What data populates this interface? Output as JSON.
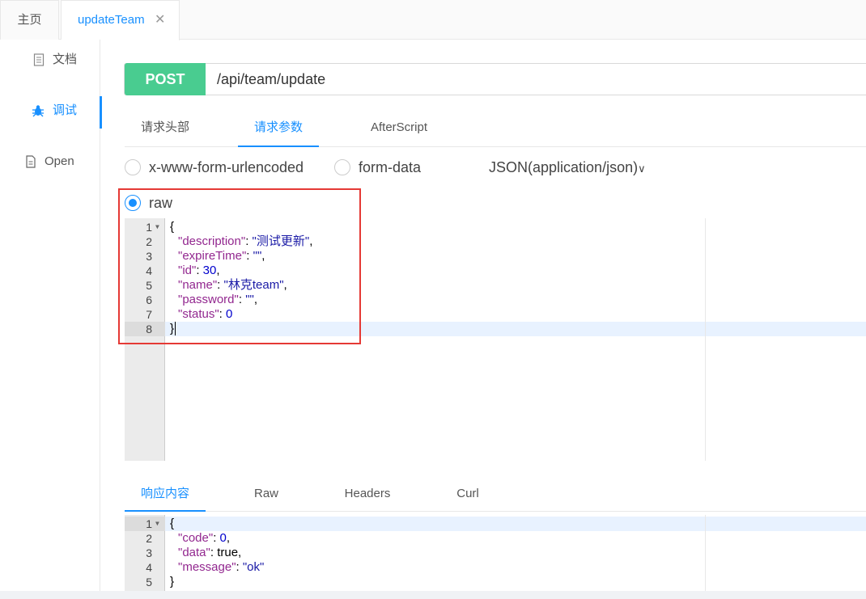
{
  "top_tabs": {
    "home": "主页",
    "active": "updateTeam",
    "close_glyph": "✕"
  },
  "sidebar": {
    "items": [
      {
        "label": "文档",
        "icon": "document-icon"
      },
      {
        "label": "调试",
        "icon": "bug-icon",
        "active": true
      },
      {
        "label": "Open",
        "icon": "file-icon"
      }
    ]
  },
  "request": {
    "method": "POST",
    "url": "/api/team/update",
    "method_color": "#49cc90"
  },
  "request_tabs": [
    "请求头部",
    "请求参数",
    "AfterScript"
  ],
  "body_types": {
    "urlencoded": "x-www-form-urlencoded",
    "formdata": "form-data",
    "raw": "raw",
    "content_type": "JSON(application/json)",
    "dropdown_glyph": "∨"
  },
  "request_body": {
    "line_numbers": [
      "1",
      "2",
      "3",
      "4",
      "5",
      "6",
      "7",
      "8"
    ],
    "open": "{",
    "close": "}",
    "fields": [
      {
        "key": "\"description\"",
        "value": "\"测试更新\"",
        "sep": ": ",
        "end": ","
      },
      {
        "key": "\"expireTime\"",
        "value": "\"\"",
        "sep": ": ",
        "end": ","
      },
      {
        "key": "\"id\"",
        "value": "30",
        "sep": ": ",
        "end": ","
      },
      {
        "key": "\"name\"",
        "value": "\"林克team\"",
        "sep": ": ",
        "end": ","
      },
      {
        "key": "\"password\"",
        "value": "\"\"",
        "sep": ": ",
        "end": ","
      },
      {
        "key": "\"status\"",
        "value": "0",
        "sep": ": ",
        "end": ""
      }
    ]
  },
  "response_tabs": [
    "响应内容",
    "Raw",
    "Headers",
    "Curl"
  ],
  "response_body": {
    "line_numbers": [
      "1",
      "2",
      "3",
      "4",
      "5"
    ],
    "open": "{",
    "close": "}",
    "fields": [
      {
        "key": "\"code\"",
        "value": "0",
        "sep": ": ",
        "end": ","
      },
      {
        "key": "\"data\"",
        "value": "true",
        "sep": ": ",
        "end": ","
      },
      {
        "key": "\"message\"",
        "value": "\"ok\"",
        "sep": ": ",
        "end": ""
      }
    ]
  },
  "colors": {
    "accent": "#1890ff",
    "highlight_box": "#e53935",
    "json_key": "#92278f",
    "json_string": "#1a1aa6"
  }
}
